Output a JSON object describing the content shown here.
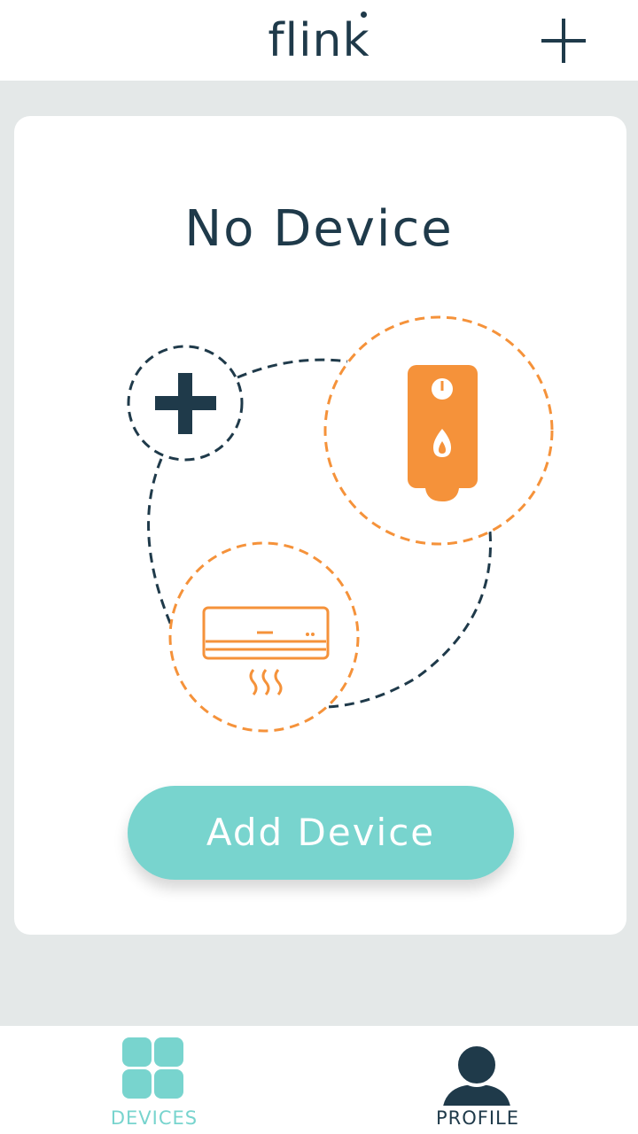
{
  "header": {
    "logo_text": "flink",
    "add_icon": "plus-icon"
  },
  "main": {
    "title": "No Device",
    "illustration_icons": [
      "plus-icon",
      "water-heater-icon",
      "air-conditioner-icon"
    ],
    "add_device_label": "Add Device"
  },
  "bottom_nav": {
    "items": [
      {
        "label": "DEVICES",
        "icon": "grid-icon",
        "active": true
      },
      {
        "label": "PROFILE",
        "icon": "user-icon",
        "active": false
      }
    ]
  },
  "colors": {
    "dark": "#1f3a4a",
    "accent": "#78d4ce",
    "orange": "#f5923a",
    "background": "#e4e8e8"
  }
}
